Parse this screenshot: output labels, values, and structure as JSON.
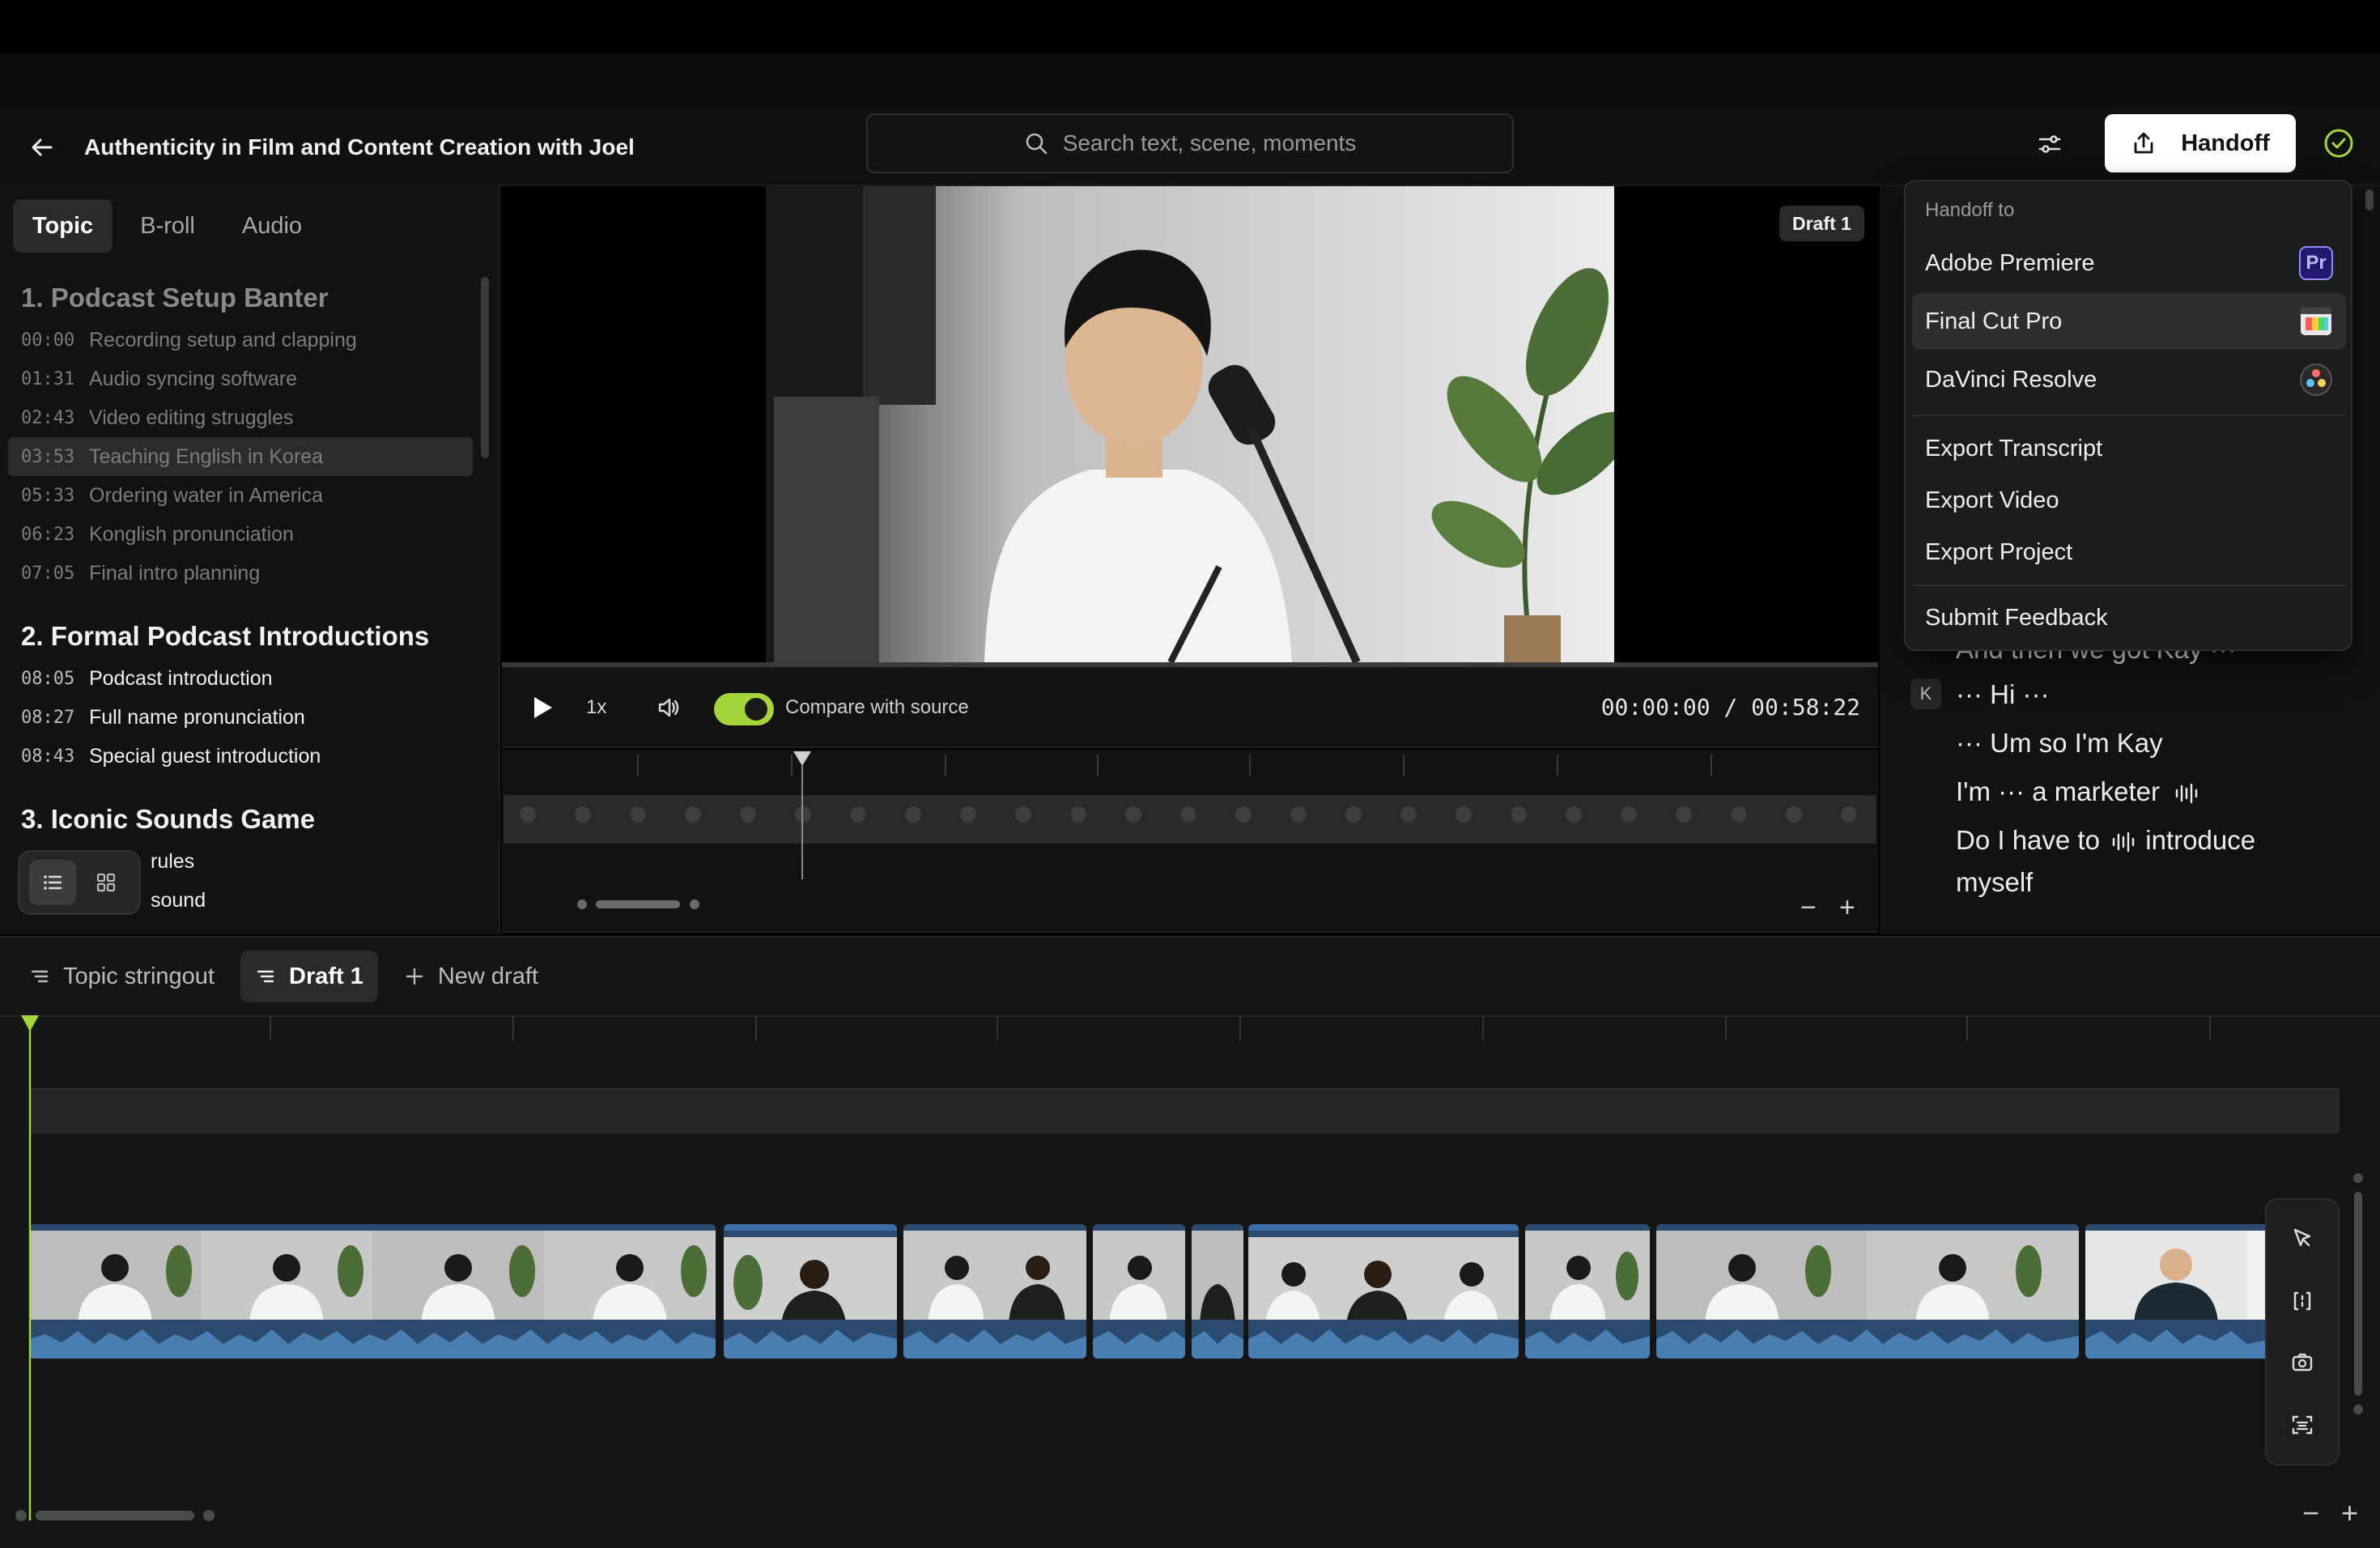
{
  "header": {
    "project_title": "Authenticity in Film and Content Creation with Joel",
    "search_placeholder": "Search text, scene, moments",
    "handoff_label": "Handoff"
  },
  "left_panel": {
    "tabs": [
      {
        "label": "Topic",
        "active": true
      },
      {
        "label": "B-roll",
        "active": false
      },
      {
        "label": "Audio",
        "active": false
      }
    ],
    "sections": [
      {
        "title": "1. Podcast Setup Banter",
        "dim": true,
        "items": [
          {
            "time": "00:00",
            "label": "Recording setup and clapping"
          },
          {
            "time": "01:31",
            "label": "Audio syncing software"
          },
          {
            "time": "02:43",
            "label": "Video editing struggles"
          },
          {
            "time": "03:53",
            "label": "Teaching English in Korea",
            "selected": true
          },
          {
            "time": "05:33",
            "label": "Ordering water in America"
          },
          {
            "time": "06:23",
            "label": "Konglish pronunciation"
          },
          {
            "time": "07:05",
            "label": "Final intro planning"
          }
        ]
      },
      {
        "title": "2. Formal Podcast Introductions",
        "dim": false,
        "items": [
          {
            "time": "08:05",
            "label": "Podcast introduction"
          },
          {
            "time": "08:27",
            "label": "Full name pronunciation"
          },
          {
            "time": "08:43",
            "label": "Special guest introduction"
          }
        ]
      },
      {
        "title": "3. Iconic Sounds Game",
        "dim": false,
        "items": [
          {
            "time": "",
            "label": "rules"
          },
          {
            "time": "",
            "label": "sound"
          }
        ]
      }
    ]
  },
  "preview": {
    "draft_badge": "Draft 1",
    "speed": "1x",
    "compare_label": "Compare with source",
    "compare_on": true,
    "timecode": "00:00:00 / 00:58:22",
    "progress": 0
  },
  "handoff_menu": {
    "heading": "Handoff to",
    "apps": [
      {
        "label": "Adobe Premiere",
        "icon": "premiere-icon",
        "icon_text": "Pr",
        "color": "#2a1f7a"
      },
      {
        "label": "Final Cut Pro",
        "icon": "final-cut-icon",
        "highlighted": true
      },
      {
        "label": "DaVinci Resolve",
        "icon": "davinci-icon"
      }
    ],
    "exports": [
      "Export Transcript",
      "Export Video",
      "Export Project"
    ],
    "feedback": "Submit Feedback"
  },
  "transcript": {
    "lines": [
      {
        "text": "And then we got Kay ···",
        "speaker": ""
      },
      {
        "text": "··· Hi ···",
        "speaker": "K"
      },
      {
        "text": "··· Um so I'm Kay",
        "speaker": ""
      },
      {
        "text": "I'm ··· a marketer",
        "speaker": "",
        "pause_marker": true
      },
      {
        "text": "Do I have to",
        "speaker": "",
        "pause_marker": true,
        "after": "introduce"
      },
      {
        "text": "myself",
        "speaker": ""
      }
    ]
  },
  "timeline": {
    "tabs": [
      {
        "label": "Topic stringout",
        "active": false
      },
      {
        "label": "Draft 1",
        "active": true
      },
      {
        "label": "New draft",
        "active": false
      }
    ]
  },
  "colors": {
    "accent": "#a4d63c",
    "clip_blue": "#2a4a6e",
    "wave_blue": "#4a7fb3",
    "background": "#121212"
  }
}
